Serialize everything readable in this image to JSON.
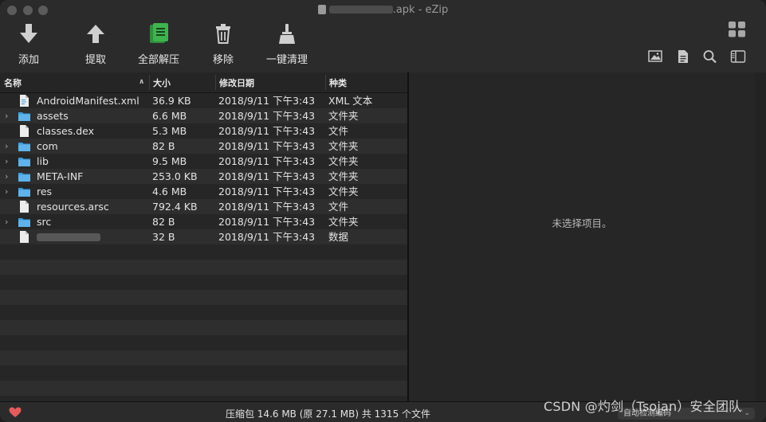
{
  "window": {
    "title_suffix": ".apk - eZip"
  },
  "toolbar": {
    "add_label": "添加",
    "extract_label": "提取",
    "extract_all_label": "全部解压",
    "remove_label": "移除",
    "clean_label": "一键清理"
  },
  "columns": {
    "name": "名称",
    "size": "大小",
    "date": "修改日期",
    "kind": "种类"
  },
  "files": [
    {
      "name": "AndroidManifest.xml",
      "size": "36.9 KB",
      "date": "2018/9/11 下午3:43",
      "kind": "XML 文本",
      "type": "xml",
      "expandable": false
    },
    {
      "name": "assets",
      "size": "6.6 MB",
      "date": "2018/9/11 下午3:43",
      "kind": "文件夹",
      "type": "folder",
      "expandable": true
    },
    {
      "name": "classes.dex",
      "size": "5.3 MB",
      "date": "2018/9/11 下午3:43",
      "kind": "文件",
      "type": "file",
      "expandable": false
    },
    {
      "name": "com",
      "size": "82 B",
      "date": "2018/9/11 下午3:43",
      "kind": "文件夹",
      "type": "folder",
      "expandable": true
    },
    {
      "name": "lib",
      "size": "9.5 MB",
      "date": "2018/9/11 下午3:43",
      "kind": "文件夹",
      "type": "folder",
      "expandable": true
    },
    {
      "name": "META-INF",
      "size": "253.0 KB",
      "date": "2018/9/11 下午3:43",
      "kind": "文件夹",
      "type": "folder",
      "expandable": true
    },
    {
      "name": "res",
      "size": "4.6 MB",
      "date": "2018/9/11 下午3:43",
      "kind": "文件夹",
      "type": "folder",
      "expandable": true
    },
    {
      "name": "resources.arsc",
      "size": "792.4 KB",
      "date": "2018/9/11 下午3:43",
      "kind": "文件",
      "type": "file",
      "expandable": false
    },
    {
      "name": "src",
      "size": "82 B",
      "date": "2018/9/11 下午3:43",
      "kind": "文件夹",
      "type": "folder",
      "expandable": true
    },
    {
      "name": "",
      "size": "32 B",
      "date": "2018/9/11 下午3:43",
      "kind": "数据",
      "type": "file",
      "expandable": false,
      "redacted": true
    }
  ],
  "preview": {
    "empty_message": "未选择项目。"
  },
  "status": {
    "summary": "压缩包 14.6 MB (原 27.1 MB) 共 1315 个文件",
    "encoding": "自动检测编码"
  },
  "watermark": "CSDN @灼剑（Tsojan）安全团队",
  "colors": {
    "folder": "#3a9bdc",
    "extract_all_icon": "#3fb34f",
    "heart": "#e45b5b"
  }
}
